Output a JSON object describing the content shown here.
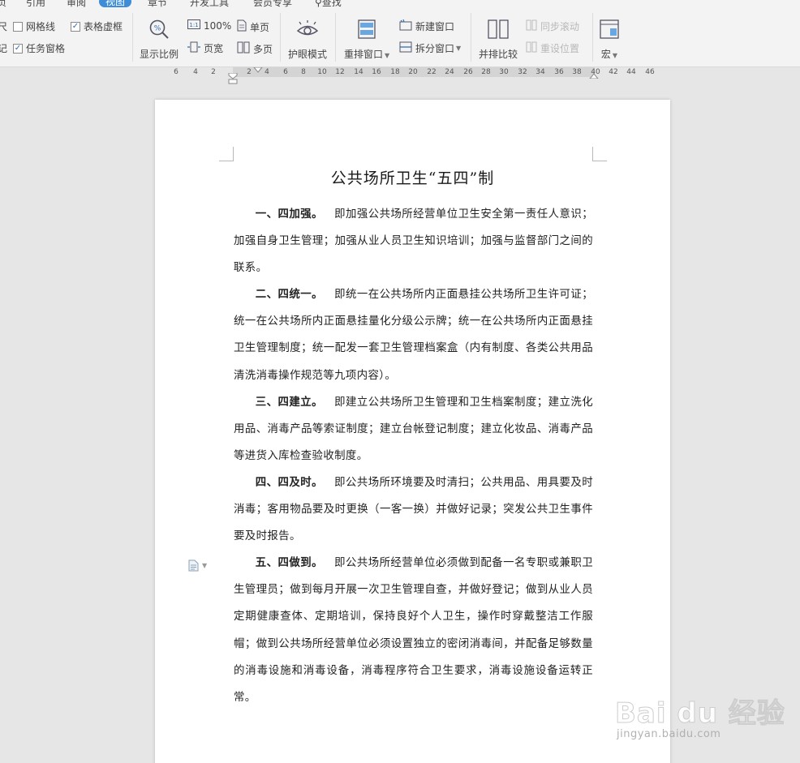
{
  "menu": {
    "tabs": [
      "页",
      "引用",
      "审阅",
      "视图",
      "章节",
      "开发工具",
      "会员专享"
    ],
    "active": "视图",
    "search": "查找"
  },
  "ribbon": {
    "partial_left_1": "尺",
    "partial_left_2": "记",
    "gridlines": "网格线",
    "gridlines_checked": false,
    "table_dashed": "表格虚框",
    "table_dashed_checked": true,
    "task_pane": "任务窗格",
    "task_pane_checked": true,
    "zoom_label": "显示比例",
    "zoom_100": "100%",
    "page_width": "页宽",
    "single_page": "单页",
    "multi_page": "多页",
    "eye_mode": "护眼模式",
    "arrange_window": "重排窗口",
    "new_window": "新建窗口",
    "split_window": "拆分窗口",
    "side_by_side": "并排比较",
    "sync_scroll": "同步滚动",
    "reset_position": "重设位置",
    "macro": "宏"
  },
  "ruler": {
    "ticks": [
      "6",
      "4",
      "2",
      "2",
      "4",
      "6",
      "8",
      "10",
      "12",
      "14",
      "16",
      "18",
      "20",
      "22",
      "24",
      "26",
      "28",
      "30",
      "32",
      "34",
      "36",
      "38",
      "40",
      "42",
      "44",
      "46"
    ]
  },
  "document": {
    "title": "公共场所卫生“五四”制",
    "paragraphs": [
      {
        "head": "一、四加强。",
        "text": "即加强公共场所经营单位卫生安全第一责任人意识；加强自身卫生管理；加强从业人员卫生知识培训；加强与监督部门之间的联系。"
      },
      {
        "head": "二、四统一。",
        "text": "即统一在公共场所内正面悬挂公共场所卫生许可证；统一在公共场所内正面悬挂量化分级公示牌；统一在公共场所内正面悬挂卫生管理制度；统一配发一套卫生管理档案盒（内有制度、各类公共用品清洗消毒操作规范等九项内容）。"
      },
      {
        "head": "三、四建立。",
        "text": "即建立公共场所卫生管理和卫生档案制度；建立洗化用品、消毒产品等索证制度；建立台帐登记制度；建立化妆品、消毒产品等进货入库检查验收制度。"
      },
      {
        "head": "四、四及时。",
        "text": "即公共场所环境要及时清扫；公共用品、用具要及时消毒；客用物品要及时更换（一客一换）并做好记录；突发公共卫生事件要及时报告。"
      },
      {
        "head": "五、四做到。",
        "text": "即公共场所经营单位必须做到配备一名专职或兼职卫生管理员；做到每月开展一次卫生管理自查，并做好登记；做到从业人员定期健康查体、定期培训，保持良好个人卫生，操作时穿戴整洁工作服帽；做到公共场所经营单位必须设置独立的密闭消毒间，并配备足够数量的消毒设施和消毒设备，消毒程序符合卫生要求，消毒设施设备运转正常。"
      }
    ]
  },
  "watermark": {
    "brand": "Bai du 经验",
    "url": "jingyan.baidu.com"
  },
  "colors": {
    "accent": "#3c8cd8",
    "ribbon_bg": "#f3f3f3",
    "canvas_bg": "#e6e6e6"
  }
}
